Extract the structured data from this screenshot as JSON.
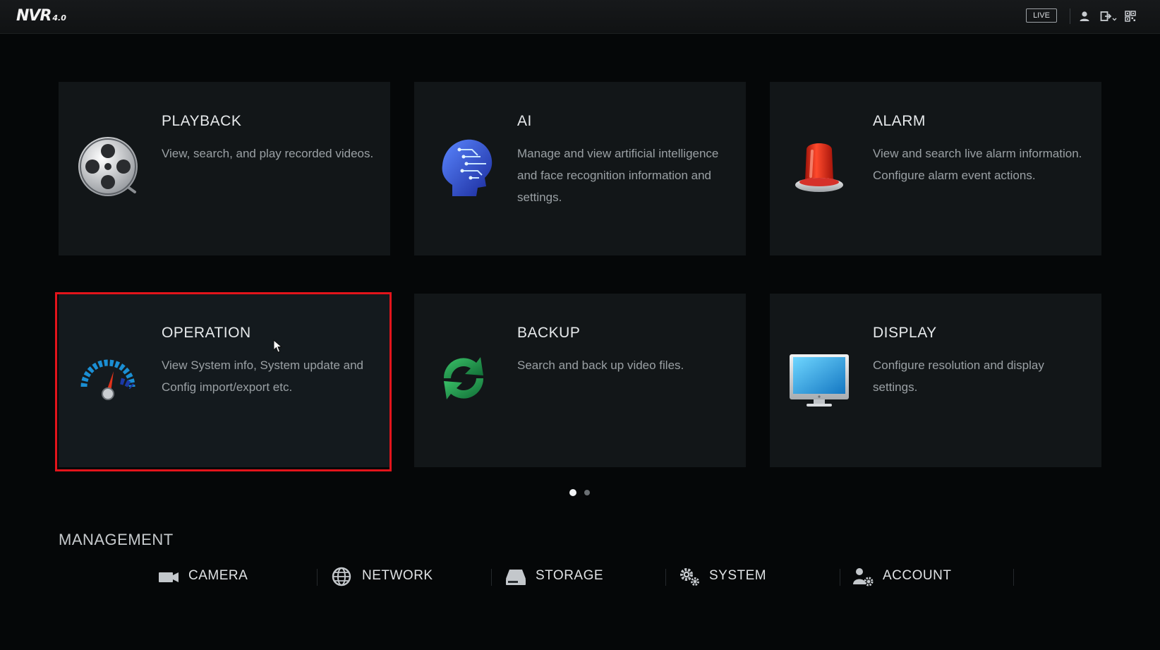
{
  "header": {
    "logo_text": "NVR",
    "logo_version": "4.0",
    "live_label": "LIVE",
    "icons": [
      "user-icon",
      "logout-icon",
      "qr-code-icon"
    ]
  },
  "cards": [
    {
      "title": "PLAYBACK",
      "description": "View, search, and play recorded videos.",
      "icon": "film-reel-icon"
    },
    {
      "title": "AI",
      "description": "Manage and view artificial intelligence and face recognition information and settings.",
      "icon": "ai-head-icon"
    },
    {
      "title": "ALARM",
      "description": "View and search live alarm information. Configure alarm event actions.",
      "icon": "alarm-siren-icon"
    },
    {
      "title": "OPERATION",
      "description": "View System info, System update and Config import/export etc.",
      "icon": "speedometer-icon"
    },
    {
      "title": "BACKUP",
      "description": "Search and back up video files.",
      "icon": "backup-sync-icon"
    },
    {
      "title": "DISPLAY",
      "description": "Configure resolution and display settings.",
      "icon": "monitor-icon"
    }
  ],
  "pager": {
    "page_count": 2,
    "current_page": 1
  },
  "management": {
    "title": "MANAGEMENT",
    "items": [
      {
        "label": "CAMERA",
        "icon": "camera-icon"
      },
      {
        "label": "NETWORK",
        "icon": "network-globe-icon"
      },
      {
        "label": "STORAGE",
        "icon": "storage-drive-icon"
      },
      {
        "label": "SYSTEM",
        "icon": "gears-icon"
      },
      {
        "label": "ACCOUNT",
        "icon": "account-settings-icon"
      }
    ]
  },
  "colors": {
    "background": "#050708",
    "card": "#121618",
    "highlight_border": "#e3141b",
    "accent_blue": "#1a9ad8",
    "accent_green": "#1f9e4e",
    "alarm_red": "#e02a1a"
  }
}
